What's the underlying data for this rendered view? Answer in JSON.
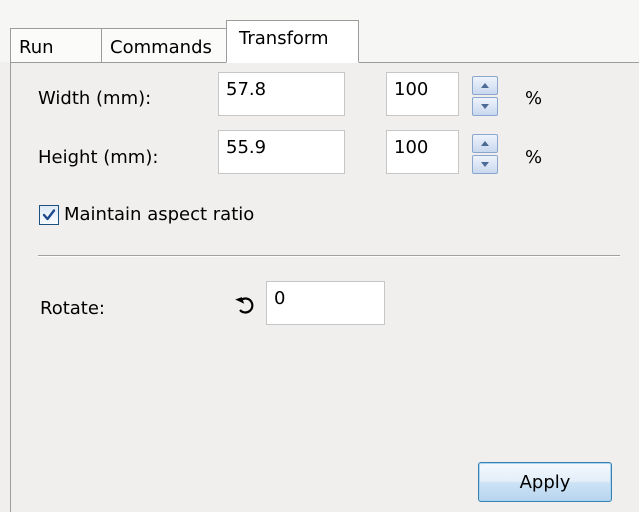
{
  "tabs": {
    "run": "Run",
    "commands": "Commands",
    "transform": "Transform"
  },
  "transform": {
    "width_label": "Width (mm):",
    "width_value": "57.8",
    "width_percent": "100",
    "height_label": "Height (mm):",
    "height_value": "55.9",
    "height_percent": "100",
    "percent_symbol": "%",
    "maintain_aspect_label": "Maintain aspect ratio",
    "maintain_aspect_checked": true,
    "rotate_label": "Rotate:",
    "rotate_value": "0",
    "apply_label": "Apply"
  },
  "icons": {
    "rotate": "rotate-ccw-icon",
    "spin_up": "arrow-up-icon",
    "spin_down": "arrow-down-icon",
    "check": "check-icon"
  },
  "colors": {
    "panel_bg": "#f0efed",
    "active_tab_bg": "#ffffff",
    "button_border": "#3c7fb1",
    "checkbox_check": "#1c4a8c"
  }
}
